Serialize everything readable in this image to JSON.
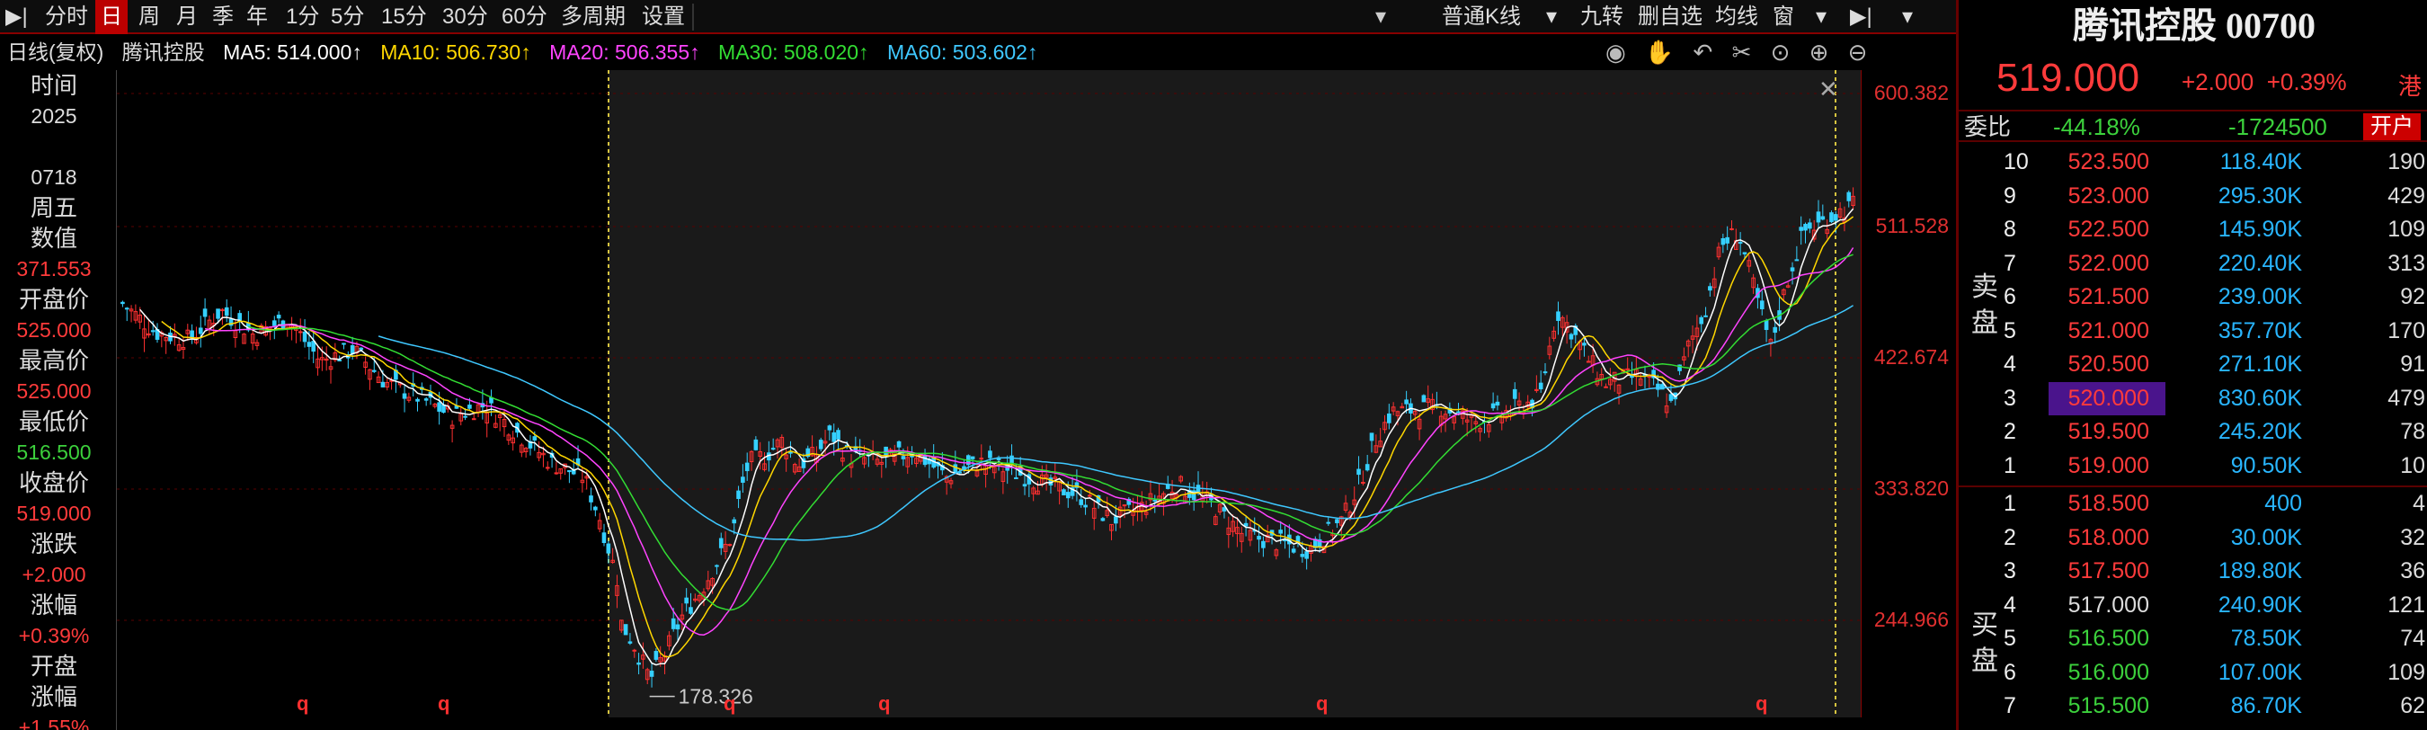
{
  "toolbar": {
    "items": [
      "分时",
      "日",
      "周",
      "月",
      "季",
      "年",
      "1分",
      "5分",
      "15分",
      "30分",
      "60分",
      "多周期",
      "设置"
    ],
    "active_index": 1,
    "kline_type": "普通K线",
    "right_items": [
      "九转",
      "删自选",
      "均线",
      "窗"
    ]
  },
  "ma_line": {
    "period": "日线(复权)",
    "stock": "腾讯控股",
    "ma5": "MA5: 514.000↑",
    "ma10": "MA10: 506.730↑",
    "ma20": "MA20: 506.355↑",
    "ma30": "MA30: 508.020↑",
    "ma60": "MA60: 503.602↑",
    "colors": {
      "ma5": "#ffffff",
      "ma10": "#ffd700",
      "ma20": "#ff44ff",
      "ma30": "#33dd33",
      "ma60": "#3fc8ff"
    }
  },
  "left_panel": [
    {
      "label": "时间",
      "value": "2025",
      "color": "#dddddd"
    },
    {
      "label": "",
      "value": "0718",
      "color": "#dddddd"
    },
    {
      "label": "周五",
      "value": "",
      "color": "#dddddd"
    },
    {
      "label": "数值",
      "value": "371.553",
      "color": "#ff3b3b"
    },
    {
      "label": "开盘价",
      "value": "525.000",
      "color": "#ff3b3b"
    },
    {
      "label": "最高价",
      "value": "525.000",
      "color": "#ff3b3b"
    },
    {
      "label": "最低价",
      "value": "516.500",
      "color": "#3cd13c"
    },
    {
      "label": "收盘价",
      "value": "519.000",
      "color": "#ff3b3b"
    },
    {
      "label": "涨跌",
      "value": "+2.000",
      "color": "#ff3b3b"
    },
    {
      "label": "涨幅",
      "value": "+0.39%",
      "color": "#ff3b3b"
    },
    {
      "label": "开盘",
      "value": "",
      "color": "#dddddd"
    },
    {
      "label": "涨幅",
      "value": "+1.55%",
      "color": "#ff3b3b"
    }
  ],
  "yaxis_labels": [
    "600.382",
    "511.528",
    "422.674",
    "333.820",
    "244.966"
  ],
  "chart": {
    "low_label": "178.326",
    "ymin": 170,
    "ymax": 605,
    "shape": [
      [
        0,
        450
      ],
      [
        0.02,
        430
      ],
      [
        0.04,
        425
      ],
      [
        0.06,
        445
      ],
      [
        0.08,
        428
      ],
      [
        0.1,
        440
      ],
      [
        0.12,
        410
      ],
      [
        0.14,
        418
      ],
      [
        0.16,
        395
      ],
      [
        0.18,
        385
      ],
      [
        0.2,
        372
      ],
      [
        0.22,
        380
      ],
      [
        0.24,
        360
      ],
      [
        0.26,
        340
      ],
      [
        0.28,
        330
      ],
      [
        0.29,
        300
      ],
      [
        0.3,
        260
      ],
      [
        0.302,
        230
      ],
      [
        0.31,
        215
      ],
      [
        0.32,
        190
      ],
      [
        0.33,
        210
      ],
      [
        0.34,
        235
      ],
      [
        0.35,
        250
      ],
      [
        0.36,
        270
      ],
      [
        0.37,
        290
      ],
      [
        0.375,
        320
      ],
      [
        0.38,
        340
      ],
      [
        0.39,
        345
      ],
      [
        0.4,
        355
      ],
      [
        0.41,
        338
      ],
      [
        0.42,
        345
      ],
      [
        0.43,
        360
      ],
      [
        0.44,
        345
      ],
      [
        0.46,
        340
      ],
      [
        0.48,
        348
      ],
      [
        0.5,
        330
      ],
      [
        0.52,
        340
      ],
      [
        0.54,
        334
      ],
      [
        0.56,
        325
      ],
      [
        0.58,
        318
      ],
      [
        0.6,
        300
      ],
      [
        0.62,
        310
      ],
      [
        0.64,
        325
      ],
      [
        0.66,
        312
      ],
      [
        0.68,
        290
      ],
      [
        0.7,
        285
      ],
      [
        0.72,
        280
      ],
      [
        0.74,
        300
      ],
      [
        0.75,
        325
      ],
      [
        0.76,
        355
      ],
      [
        0.77,
        375
      ],
      [
        0.78,
        376
      ],
      [
        0.8,
        378
      ],
      [
        0.82,
        368
      ],
      [
        0.84,
        375
      ],
      [
        0.86,
        385
      ],
      [
        0.87,
        445
      ],
      [
        0.88,
        430
      ],
      [
        0.89,
        410
      ],
      [
        0.9,
        395
      ],
      [
        0.92,
        400
      ],
      [
        0.93,
        392
      ],
      [
        0.94,
        380
      ],
      [
        0.95,
        420
      ],
      [
        0.96,
        445
      ],
      [
        0.97,
        490
      ],
      [
        0.98,
        500
      ],
      [
        0.99,
        460
      ],
      [
        1,
        420
      ],
      [
        1.01,
        465
      ],
      [
        1.02,
        500
      ],
      [
        1.03,
        505
      ],
      [
        1.04,
        512
      ],
      [
        1.05,
        518
      ]
    ]
  },
  "right_panel": {
    "title": "腾讯控股 00700",
    "price": "519.000",
    "change": "+2.000",
    "change_pct": "+0.39%",
    "market": "港",
    "ratio_label": "委比",
    "ratio_pct": "-44.18%",
    "ratio_diff": "-1724500",
    "account_button": "开户",
    "sell_label": [
      "卖",
      "盘"
    ],
    "buy_label": [
      "买",
      "盘"
    ],
    "asks": [
      {
        "level": "10",
        "price": "523.500",
        "volume": "118.40K",
        "count": "190"
      },
      {
        "level": "9",
        "price": "523.000",
        "volume": "295.30K",
        "count": "429"
      },
      {
        "level": "8",
        "price": "522.500",
        "volume": "145.90K",
        "count": "109"
      },
      {
        "level": "7",
        "price": "522.000",
        "volume": "220.40K",
        "count": "313"
      },
      {
        "level": "6",
        "price": "521.500",
        "volume": "239.00K",
        "count": "92"
      },
      {
        "level": "5",
        "price": "521.000",
        "volume": "357.70K",
        "count": "170"
      },
      {
        "level": "4",
        "price": "520.500",
        "volume": "271.10K",
        "count": "91"
      },
      {
        "level": "3",
        "price": "520.000",
        "volume": "830.60K",
        "count": "479"
      },
      {
        "level": "2",
        "price": "519.500",
        "volume": "245.20K",
        "count": "78"
      },
      {
        "level": "1",
        "price": "519.000",
        "volume": "90.50K",
        "count": "10"
      }
    ],
    "bids": [
      {
        "level": "1",
        "price": "518.500",
        "volume": "400",
        "count": "4",
        "color": "#ff3b3b"
      },
      {
        "level": "2",
        "price": "518.000",
        "volume": "30.00K",
        "count": "32",
        "color": "#ff3b3b"
      },
      {
        "level": "3",
        "price": "517.500",
        "volume": "189.80K",
        "count": "36",
        "color": "#ff3b3b"
      },
      {
        "level": "4",
        "price": "517.000",
        "volume": "240.90K",
        "count": "121",
        "color": "#dddddd"
      },
      {
        "level": "5",
        "price": "516.500",
        "volume": "78.50K",
        "count": "74",
        "color": "#3cd13c"
      },
      {
        "level": "6",
        "price": "516.000",
        "volume": "107.00K",
        "count": "109",
        "color": "#3cd13c"
      },
      {
        "level": "7",
        "price": "515.500",
        "volume": "86.70K",
        "count": "62",
        "color": "#3cd13c"
      }
    ]
  }
}
